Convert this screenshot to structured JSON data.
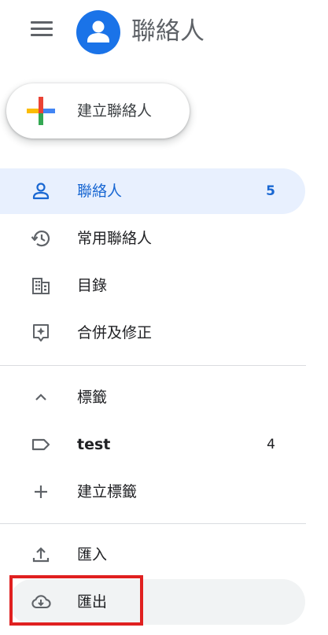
{
  "header": {
    "title": "聯絡人"
  },
  "create_button": {
    "label": "建立聯絡人"
  },
  "nav": {
    "contacts": {
      "label": "聯絡人",
      "count": "5"
    },
    "frequent": {
      "label": "常用聯絡人"
    },
    "directory": {
      "label": "目錄"
    },
    "merge": {
      "label": "合併及修正"
    }
  },
  "labels_section": {
    "header": "標籤",
    "items": [
      {
        "label": "test",
        "count": "4"
      }
    ],
    "create_label": "建立標籤"
  },
  "footer": {
    "import_label": "匯入",
    "export_label": "匯出"
  },
  "colors": {
    "accent": "#1a73e8",
    "active_bg": "#e8f0fe",
    "active_text": "#1967d2",
    "highlight": "#e02020"
  }
}
